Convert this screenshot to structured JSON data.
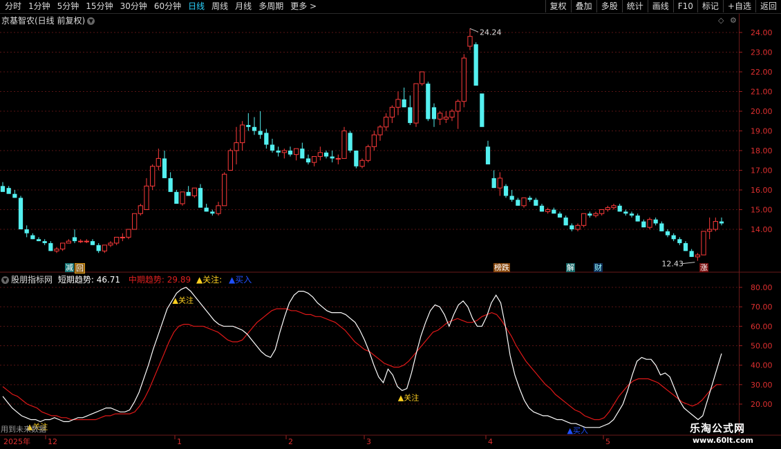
{
  "toolbar": {
    "periods": [
      "分时",
      "1分钟",
      "5分钟",
      "15分钟",
      "30分钟",
      "60分钟",
      "日线",
      "周线",
      "月线",
      "多周期",
      "更多 >"
    ],
    "active": "日线",
    "right_buttons": [
      "复权",
      "叠加",
      "多股",
      "统计",
      "画线",
      "F10",
      "标记",
      "+自选",
      "返回"
    ]
  },
  "chart_header": {
    "stock": "京基智农(日线 前复权)"
  },
  "price_axis": {
    "labels": [
      "24.00",
      "23.00",
      "22.00",
      "21.00",
      "20.00",
      "19.00",
      "18.00",
      "17.00",
      "16.00",
      "15.00",
      "14.00"
    ]
  },
  "price_marks": {
    "high": "24.24",
    "low": "12.43"
  },
  "event_tags": [
    {
      "text": "减",
      "color": "#1fd3d3"
    },
    {
      "text": "回",
      "color": "#e0a020"
    },
    {
      "text": "榜跌",
      "color": "#ff8c1a"
    },
    {
      "text": "解",
      "color": "#1fd3d3"
    },
    {
      "text": "财",
      "color": "#2ad3ff"
    },
    {
      "text": "涨",
      "color": "#ff4040"
    }
  ],
  "indicator": {
    "name": "股朋指标网",
    "short_label": "短期趋势: 46.71",
    "mid_label": "中期趋势: 29.89",
    "watch_label": "▲关注:",
    "buy_label": "▲买入",
    "axis_labels": [
      "80.00",
      "70.00",
      "60.00",
      "50.00",
      "40.00",
      "30.00",
      "20.00"
    ],
    "signals": [
      "▲关注",
      "▲关注",
      "▲关注",
      "▲买入"
    ]
  },
  "bottom_axis": {
    "labels": [
      "2025年",
      "12",
      "1",
      "2",
      "3",
      "4",
      "5"
    ]
  },
  "note": "用到未来数据",
  "watermark": {
    "line1": "乐淘公式网",
    "line2": "www.60lt.com"
  },
  "colors": {
    "up": "#ff3b3b",
    "down": "#54f0f0",
    "short": "#ffffff",
    "mid": "#e01818",
    "grid": "#6a1a1a"
  },
  "chart_data": {
    "type": "candlestick",
    "ohlc": [
      [
        16.2,
        16.4,
        16.0,
        15.9
      ],
      [
        16.1,
        16.2,
        15.9,
        15.8
      ],
      [
        15.8,
        16.0,
        15.6,
        15.6
      ],
      [
        15.6,
        15.7,
        14.0,
        14.0
      ],
      [
        14.0,
        14.2,
        13.6,
        13.8
      ],
      [
        13.7,
        13.8,
        13.5,
        13.5
      ],
      [
        13.5,
        13.6,
        13.4,
        13.4
      ],
      [
        13.4,
        13.5,
        13.2,
        13.3
      ],
      [
        13.3,
        13.4,
        12.9,
        12.9
      ],
      [
        12.9,
        13.1,
        12.8,
        13.0
      ],
      [
        13.0,
        13.3,
        12.9,
        13.3
      ],
      [
        13.3,
        13.5,
        13.3,
        13.4
      ],
      [
        13.6,
        14.0,
        13.3,
        13.4
      ],
      [
        13.4,
        13.5,
        13.3,
        13.4
      ],
      [
        13.4,
        13.5,
        13.3,
        13.4
      ],
      [
        13.4,
        13.5,
        13.2,
        13.2
      ],
      [
        13.2,
        13.3,
        12.8,
        12.9
      ],
      [
        12.9,
        13.2,
        12.8,
        13.2
      ],
      [
        13.2,
        13.4,
        13.1,
        13.3
      ],
      [
        13.3,
        13.6,
        13.2,
        13.6
      ],
      [
        13.6,
        13.8,
        13.4,
        13.6
      ],
      [
        13.6,
        14.0,
        13.5,
        14.0
      ],
      [
        14.0,
        14.8,
        14.0,
        14.8
      ],
      [
        14.8,
        15.3,
        14.7,
        15.2
      ],
      [
        15.0,
        16.6,
        15.0,
        16.2
      ],
      [
        16.2,
        17.3,
        16.0,
        17.2
      ],
      [
        17.2,
        18.1,
        17.0,
        17.6
      ],
      [
        17.6,
        18.0,
        16.6,
        16.6
      ],
      [
        16.6,
        16.9,
        15.9,
        15.9
      ],
      [
        15.9,
        16.0,
        15.3,
        15.3
      ],
      [
        15.3,
        15.9,
        15.2,
        15.9
      ],
      [
        15.9,
        16.2,
        15.7,
        15.7
      ],
      [
        15.7,
        16.1,
        15.6,
        16.1
      ],
      [
        16.1,
        16.3,
        15.1,
        15.1
      ],
      [
        15.1,
        15.3,
        14.9,
        14.9
      ],
      [
        14.9,
        15.0,
        14.7,
        14.8
      ],
      [
        14.8,
        15.4,
        14.7,
        15.2
      ],
      [
        15.2,
        16.9,
        15.2,
        16.8
      ],
      [
        17.0,
        18.1,
        17.3,
        18.0
      ],
      [
        18.0,
        19.2,
        17.3,
        18.4
      ],
      [
        18.4,
        19.5,
        18.0,
        19.3
      ],
      [
        19.3,
        19.9,
        19.0,
        19.2
      ],
      [
        19.2,
        19.7,
        18.8,
        19.0
      ],
      [
        19.0,
        20.0,
        18.6,
        18.8
      ],
      [
        18.9,
        19.1,
        18.1,
        18.3
      ],
      [
        18.3,
        18.6,
        17.9,
        18.0
      ],
      [
        18.0,
        18.2,
        17.7,
        17.9
      ],
      [
        17.9,
        18.1,
        17.6,
        18.0
      ],
      [
        18.0,
        18.2,
        17.7,
        17.8
      ],
      [
        17.8,
        18.1,
        17.5,
        18.1
      ],
      [
        18.1,
        18.4,
        17.7,
        17.6
      ],
      [
        17.6,
        17.8,
        17.3,
        17.4
      ],
      [
        17.4,
        17.7,
        17.2,
        17.7
      ],
      [
        17.7,
        18.2,
        17.5,
        17.9
      ],
      [
        17.9,
        18.0,
        17.6,
        17.7
      ],
      [
        17.7,
        18.0,
        17.4,
        17.6
      ],
      [
        17.6,
        17.8,
        17.3,
        17.6
      ],
      [
        17.6,
        19.2,
        17.6,
        19.0
      ],
      [
        18.9,
        19.0,
        17.9,
        18.0
      ],
      [
        18.0,
        18.0,
        17.1,
        17.2
      ],
      [
        17.2,
        17.6,
        17.1,
        17.5
      ],
      [
        17.5,
        18.3,
        17.4,
        18.2
      ],
      [
        18.2,
        19.0,
        18.0,
        18.8
      ],
      [
        18.8,
        19.3,
        18.5,
        19.2
      ],
      [
        19.2,
        19.9,
        19.0,
        19.7
      ],
      [
        19.7,
        20.3,
        19.4,
        20.2
      ],
      [
        20.2,
        21.0,
        19.8,
        20.6
      ],
      [
        20.6,
        21.2,
        20.2,
        20.2
      ],
      [
        20.2,
        20.8,
        19.3,
        19.4
      ],
      [
        19.4,
        21.4,
        19.2,
        21.4
      ],
      [
        21.4,
        22.0,
        21.3,
        22.0
      ],
      [
        21.4,
        21.5,
        19.5,
        19.6
      ],
      [
        20.2,
        20.4,
        19.2,
        19.6
      ],
      [
        19.6,
        20.0,
        19.3,
        19.9
      ],
      [
        19.6,
        20.0,
        19.4,
        19.7
      ],
      [
        19.7,
        20.1,
        19.5,
        20.0
      ],
      [
        20.0,
        20.6,
        19.1,
        20.5
      ],
      [
        20.5,
        22.9,
        20.2,
        22.7
      ],
      [
        23.3,
        24.2,
        23.1,
        23.8
      ],
      [
        23.4,
        23.5,
        21.3,
        21.3
      ],
      [
        20.9,
        20.6,
        20.2,
        19.2
      ],
      [
        18.2,
        18.5,
        17.3,
        17.3
      ],
      [
        16.6,
        17.0,
        16.1,
        16.1
      ],
      [
        16.1,
        16.9,
        15.7,
        16.6
      ],
      [
        16.2,
        16.3,
        15.6,
        15.7
      ],
      [
        15.7,
        16.0,
        15.4,
        15.5
      ],
      [
        15.5,
        15.6,
        15.2,
        15.2
      ],
      [
        15.2,
        15.6,
        15.1,
        15.6
      ],
      [
        15.6,
        15.7,
        15.4,
        15.5
      ],
      [
        15.5,
        15.6,
        15.2,
        15.2
      ],
      [
        15.2,
        15.3,
        14.9,
        14.9
      ],
      [
        14.9,
        15.1,
        14.8,
        15.0
      ],
      [
        15.0,
        15.1,
        14.8,
        14.8
      ],
      [
        14.8,
        14.9,
        14.6,
        14.6
      ],
      [
        14.6,
        14.7,
        14.2,
        14.2
      ],
      [
        14.2,
        14.3,
        13.9,
        14.0
      ],
      [
        14.0,
        14.3,
        13.9,
        14.2
      ],
      [
        14.2,
        14.8,
        14.1,
        14.8
      ],
      [
        14.8,
        14.9,
        14.6,
        14.7
      ],
      [
        14.7,
        14.9,
        14.6,
        14.8
      ],
      [
        14.8,
        15.0,
        14.7,
        15.0
      ],
      [
        15.0,
        15.2,
        14.9,
        15.1
      ],
      [
        15.1,
        15.3,
        15.0,
        15.2
      ],
      [
        15.2,
        15.3,
        14.9,
        14.9
      ],
      [
        14.9,
        15.0,
        14.7,
        14.8
      ],
      [
        14.8,
        14.9,
        14.6,
        14.7
      ],
      [
        14.7,
        14.8,
        14.4,
        14.4
      ],
      [
        14.4,
        14.5,
        14.1,
        14.1
      ],
      [
        14.1,
        14.6,
        14.0,
        14.5
      ],
      [
        14.5,
        14.6,
        14.2,
        14.3
      ],
      [
        14.3,
        14.4,
        13.9,
        13.9
      ],
      [
        13.9,
        14.0,
        13.6,
        13.7
      ],
      [
        13.7,
        13.8,
        13.4,
        13.5
      ],
      [
        13.5,
        13.6,
        13.2,
        13.3
      ],
      [
        13.3,
        13.4,
        12.9,
        12.9
      ],
      [
        12.9,
        13.0,
        12.6,
        12.6
      ],
      [
        12.6,
        12.8,
        12.4,
        12.7
      ],
      [
        12.7,
        13.9,
        12.7,
        13.9
      ],
      [
        13.9,
        14.6,
        13.5,
        14.0
      ],
      [
        14.0,
        14.6,
        13.9,
        14.4
      ],
      [
        14.4,
        14.6,
        14.2,
        14.3
      ]
    ],
    "short_trend": [
      24,
      21,
      18,
      16,
      14,
      13,
      12,
      12,
      11,
      12,
      12,
      13,
      12,
      11,
      11,
      12,
      13,
      13,
      14,
      15,
      16,
      17,
      18,
      18,
      17,
      16,
      16,
      17,
      21,
      26,
      33,
      40,
      48,
      55,
      62,
      69,
      73,
      77,
      79,
      80,
      78,
      75,
      72,
      69,
      66,
      63,
      61,
      60,
      60,
      60,
      59,
      58,
      56,
      53,
      50,
      47,
      45,
      44,
      48,
      57,
      65,
      72,
      76,
      78,
      78,
      77,
      75,
      72,
      70,
      68,
      67,
      67,
      67,
      66,
      64,
      62,
      58,
      53,
      47,
      40,
      34,
      31,
      38,
      35,
      29,
      27,
      28,
      36,
      46,
      55,
      62,
      68,
      71,
      70,
      66,
      60,
      66,
      71,
      73,
      70,
      64,
      60,
      60,
      65,
      72,
      76,
      72,
      60,
      45,
      35,
      28,
      22,
      18,
      16,
      15,
      14,
      14,
      13,
      12,
      12,
      11,
      10,
      10,
      9,
      8,
      8,
      8,
      8,
      9,
      10,
      12,
      16,
      20,
      27,
      35,
      42,
      44,
      43,
      43,
      40,
      35,
      36,
      34,
      28,
      22,
      18,
      16,
      14,
      12,
      14,
      22,
      30,
      38,
      46
    ],
    "mid_trend": [
      29,
      27,
      25,
      24,
      22,
      20,
      19,
      18,
      16,
      15,
      14,
      14,
      13,
      13,
      12,
      12,
      12,
      12,
      12,
      12,
      13,
      14,
      14,
      15,
      15,
      15,
      15,
      16,
      19,
      23,
      28,
      34,
      40,
      46,
      52,
      57,
      60,
      61,
      61,
      60,
      60,
      60,
      59,
      58,
      57,
      55,
      53,
      52,
      52,
      53,
      56,
      59,
      62,
      64,
      66,
      68,
      69,
      69,
      69,
      68,
      68,
      67,
      66,
      66,
      65,
      65,
      64,
      63,
      62,
      60,
      58,
      55,
      52,
      50,
      48,
      47,
      45,
      43,
      41,
      40,
      39,
      39,
      40,
      42,
      45,
      48,
      51,
      54,
      57,
      58,
      60,
      62,
      63,
      64,
      63,
      62,
      62,
      63,
      65,
      66,
      67,
      66,
      63,
      59,
      55,
      50,
      46,
      42,
      39,
      36,
      33,
      30,
      28,
      25,
      23,
      21,
      19,
      17,
      16,
      14,
      13,
      12,
      12,
      13,
      16,
      20,
      24,
      27,
      30,
      32,
      33,
      33,
      33,
      32,
      31,
      29,
      27,
      25,
      23,
      21,
      20,
      19,
      20,
      22,
      25,
      28,
      30,
      30
    ],
    "signals": [
      {
        "type": "关注",
        "index": 6
      },
      {
        "type": "关注",
        "index": 37
      },
      {
        "type": "关注",
        "index": 85
      },
      {
        "type": "买入",
        "index": 121
      }
    ]
  }
}
